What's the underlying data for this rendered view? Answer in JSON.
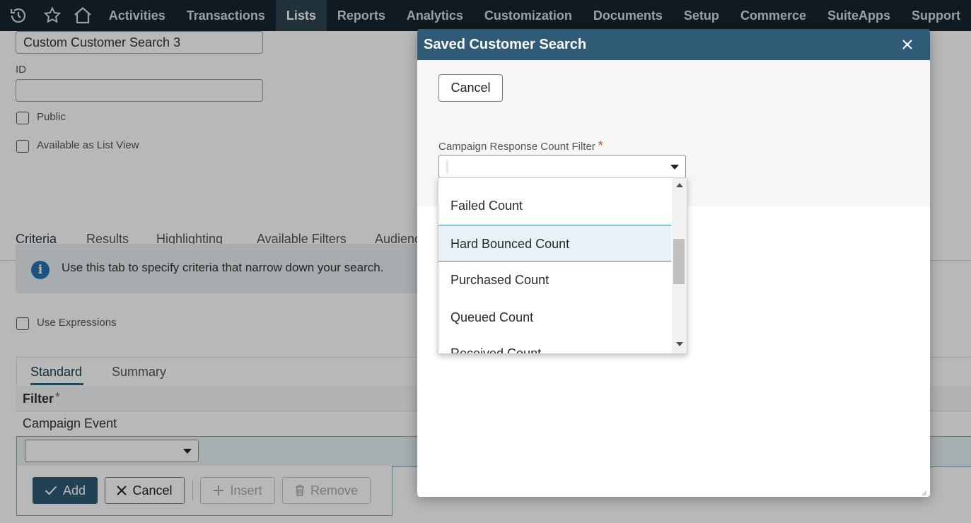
{
  "topnav": {
    "icons": [
      "history-icon",
      "star-icon",
      "home-icon"
    ],
    "items": [
      "Activities",
      "Transactions",
      "Lists",
      "Reports",
      "Analytics",
      "Customization",
      "Documents",
      "Setup",
      "Commerce",
      "SuiteApps",
      "Support"
    ],
    "active": "Lists"
  },
  "page": {
    "search_title_value": "Custom Customer Search 3",
    "id_label": "ID",
    "id_value": "",
    "public_label": "Public",
    "list_view_label": "Available as List View",
    "tabs": [
      "Criteria",
      "Results",
      "Highlighting",
      "Available Filters",
      "Audienc"
    ],
    "active_tab": "Criteria",
    "info_text": "Use this tab to specify criteria that narrow down your search.",
    "use_expressions_label": "Use Expressions",
    "subtabs": [
      "Standard",
      "Summary"
    ],
    "filter_header": "Filter",
    "filter_required": "*",
    "filter_value": "Campaign Event",
    "buttons": {
      "add": "Add",
      "cancel": "Cancel",
      "insert": "Insert",
      "remove": "Remove"
    }
  },
  "modal": {
    "title": "Saved Customer Search",
    "cancel_label": "Cancel",
    "field_label": "Campaign Response Count Filter",
    "required_mark": "*",
    "select_value": "",
    "options": [
      "Failed Count",
      "Hard Bounced Count",
      "Purchased Count",
      "Queued Count",
      "Received Count"
    ],
    "highlighted_option": "Hard Bounced Count"
  },
  "colors": {
    "nav_bg": "#15242f",
    "nav_active": "#2f4553",
    "modal_header": "#2f5b76",
    "primary_button": "#2f5b76",
    "accent": "#2a6a80"
  }
}
